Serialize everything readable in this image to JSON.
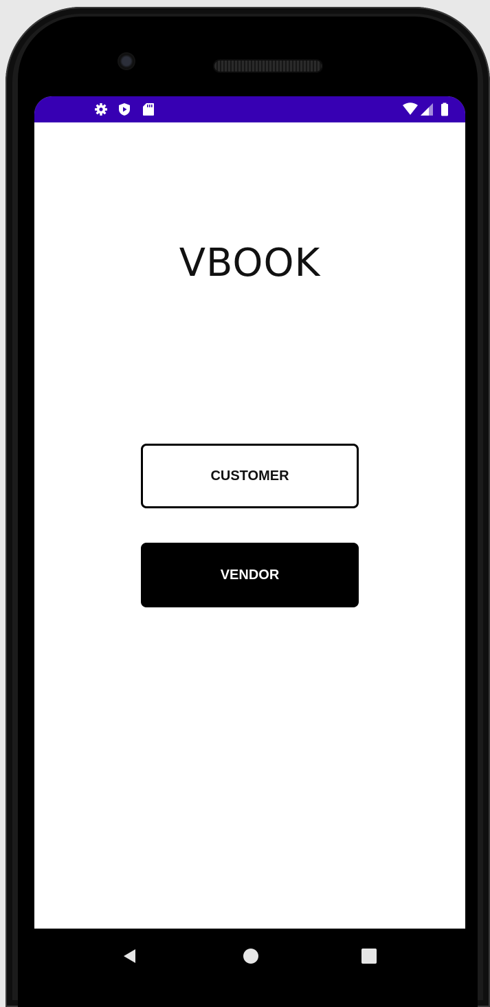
{
  "app": {
    "title": "VBOOK"
  },
  "buttons": {
    "customer_label": "CUSTOMER",
    "vendor_label": "VENDOR"
  },
  "status_bar": {
    "color": "#3700b3",
    "left_icons": [
      "settings-icon",
      "shield-icon",
      "sd-card-icon"
    ],
    "right_icons": [
      "wifi-icon",
      "signal-icon",
      "battery-icon"
    ]
  },
  "nav_bar": {
    "items": [
      "back-icon",
      "home-icon",
      "recents-icon"
    ]
  }
}
